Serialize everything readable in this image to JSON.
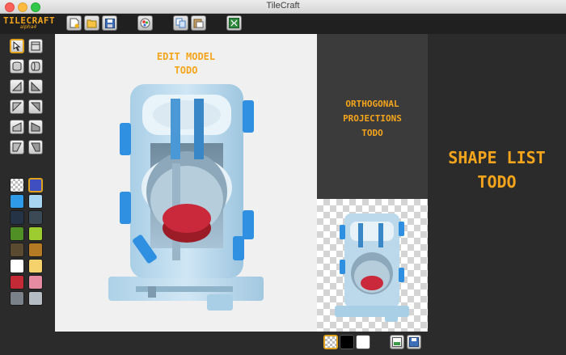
{
  "window": {
    "title": "TileCraft"
  },
  "logo": {
    "title": "TILECRAFT",
    "subtitle": "alpha4"
  },
  "toolbar": {
    "buttons": [
      "new-file-icon",
      "open-folder-icon",
      "save-icon",
      "render-icon",
      "copy-icon",
      "paste-icon",
      "export-icon"
    ]
  },
  "palette": {
    "tools": [
      "pointer-icon",
      "box-icon",
      "cylinder-v-icon",
      "cylinder-h-icon",
      "wedge-1-icon",
      "wedge-2-icon",
      "wedge-3-icon",
      "wedge-4-icon",
      "wedge-5-icon",
      "wedge-6-icon",
      "wedge-7-icon",
      "wedge-8-icon"
    ],
    "selected_tool": 0,
    "colors": [
      "transparent",
      "#3f4fbf",
      "#2f9ae8",
      "#a7d4f0",
      "#253347",
      "#3b4a54",
      "#4f8f26",
      "#9ccc2f",
      "#5a4a2f",
      "#b47a24",
      "#ffffff",
      "#f5d26b",
      "#c42a36",
      "#e68ba1",
      "#7b8188",
      "#b5bcc4"
    ],
    "selected_color": 1
  },
  "edit_panel": {
    "todo_text": "EDIT MODEL\nTODO"
  },
  "ortho_panel": {
    "todo_text": "ORTHOGONAL\nPROJECTIONS\nTODO"
  },
  "shape_list": {
    "todo_text": "SHAPE LIST\nTODO"
  },
  "bottombar": {
    "background_swatches": [
      "transparent",
      "#000000",
      "#ffffff"
    ],
    "selected_background": 0,
    "buttons": [
      "export-image-icon",
      "save-image-icon"
    ]
  },
  "accent_color": "#f4a51c"
}
